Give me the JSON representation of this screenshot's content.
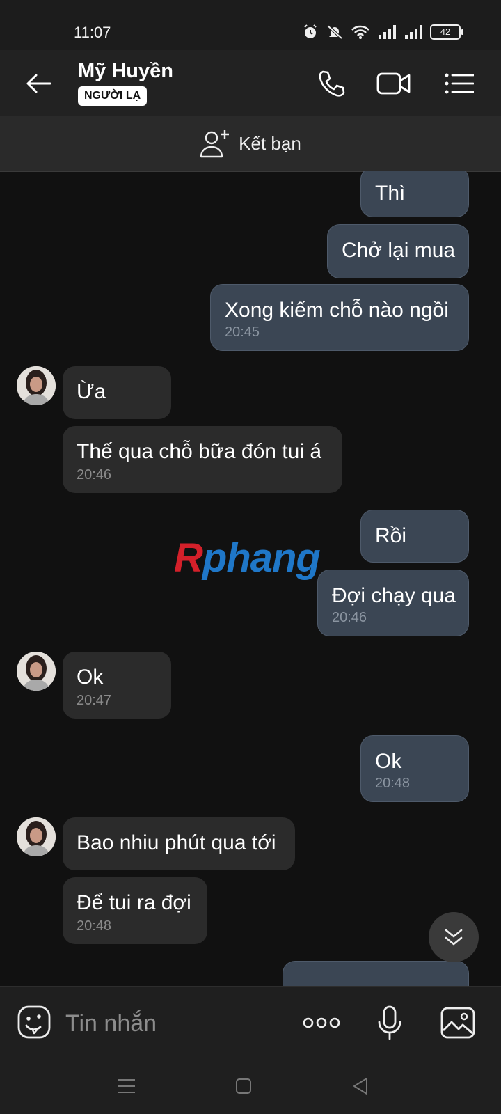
{
  "status": {
    "time": "11:07",
    "battery": "42"
  },
  "header": {
    "name": "Mỹ Huyền",
    "badge": "NGƯỜI LẠ"
  },
  "friend_bar": {
    "label": "Kết bạn"
  },
  "messages": [
    {
      "dir": "out",
      "text": "Thì",
      "time": ""
    },
    {
      "dir": "out",
      "text": "Chở lại mua",
      "time": ""
    },
    {
      "dir": "out",
      "text": "Xong kiếm chỗ nào ngồi",
      "time": "20:45"
    },
    {
      "dir": "in",
      "text": "Ừa",
      "time": ""
    },
    {
      "dir": "in",
      "text": "Thế qua chỗ bữa đón tui á",
      "time": "20:46"
    },
    {
      "dir": "out",
      "text": "Rồi",
      "time": ""
    },
    {
      "dir": "out",
      "text": "Đợi chạy qua",
      "time": "20:46"
    },
    {
      "dir": "in",
      "text": "Ok",
      "time": "20:47"
    },
    {
      "dir": "out",
      "text": "Ok",
      "time": "20:48"
    },
    {
      "dir": "in",
      "text": "Bao nhiu phút qua tới",
      "time": ""
    },
    {
      "dir": "in",
      "text": "Để tui ra đợi",
      "time": "20:48"
    }
  ],
  "watermark": {
    "first": "R",
    "rest": "phang"
  },
  "input": {
    "placeholder": "Tin nhắn"
  },
  "icons": {
    "back": "arrow-left-icon",
    "call": "phone-icon",
    "video": "video-camera-icon",
    "menu": "list-menu-icon",
    "add_friend": "add-user-icon",
    "emoji": "emoji-icon",
    "more": "more-dots-icon",
    "mic": "microphone-icon",
    "gallery": "image-icon",
    "scroll_down": "double-chevron-down-icon"
  },
  "colors": {
    "outgoing_bubble": "#3b4654",
    "incoming_bubble": "#2b2b2b",
    "background": "#111111"
  }
}
